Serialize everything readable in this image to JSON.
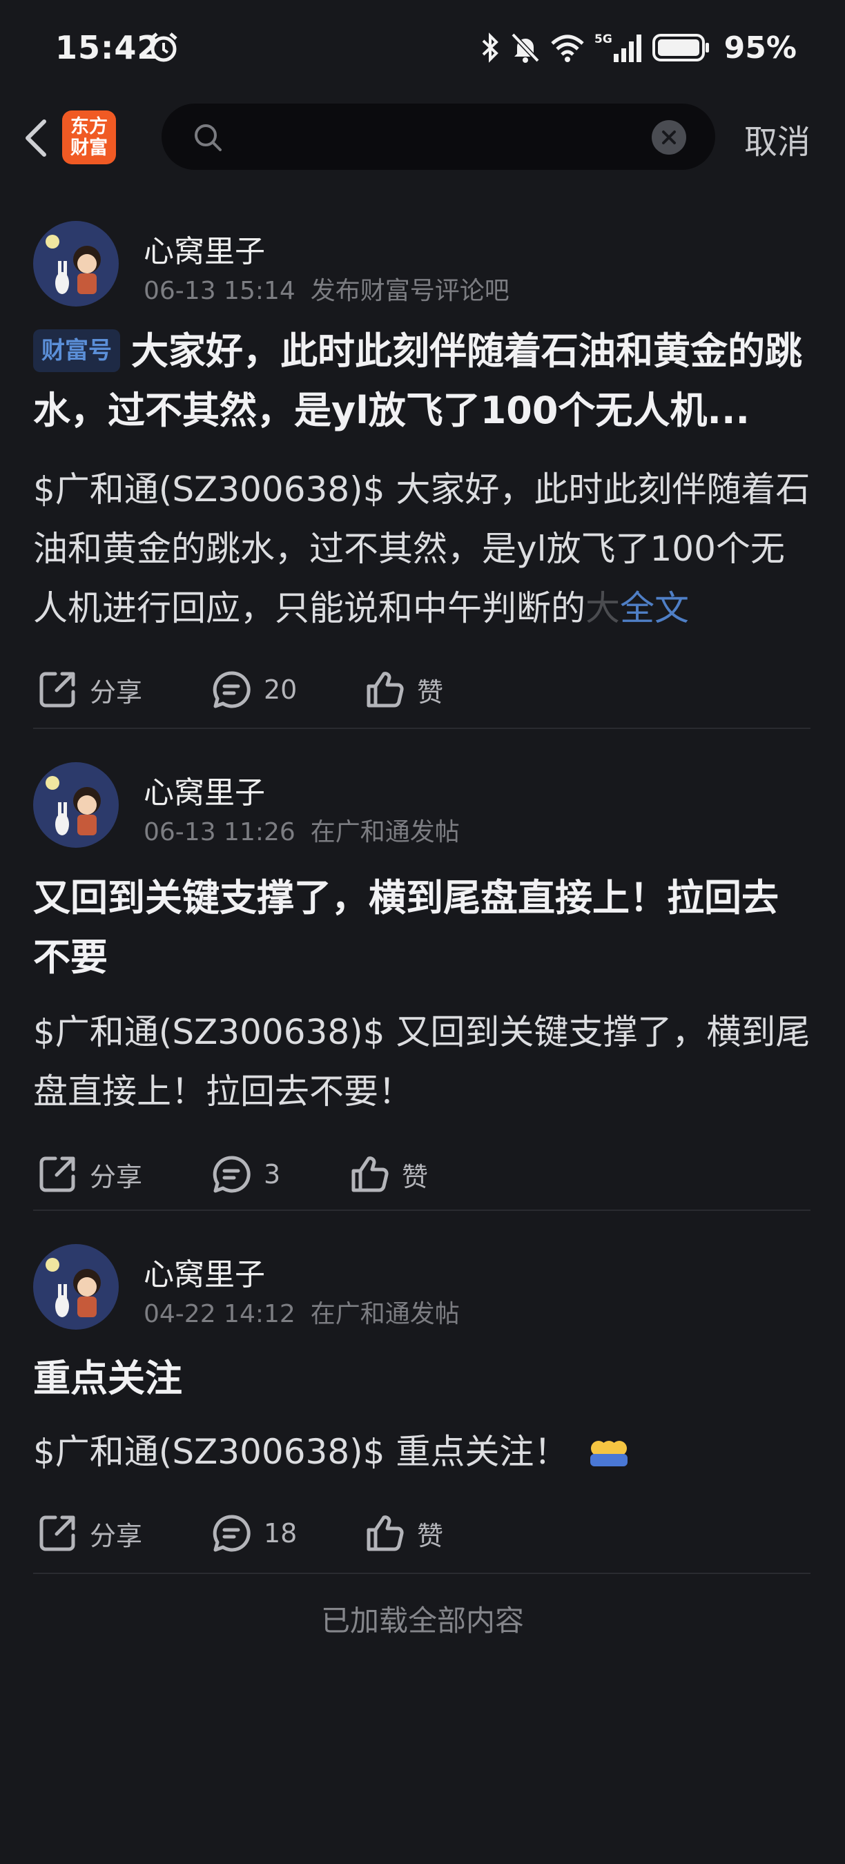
{
  "status_bar": {
    "time": "15:42",
    "battery": "95%",
    "icons": [
      "alarm-icon",
      "bluetooth-icon",
      "mute-icon",
      "wifi-icon",
      "5g-signal-icon",
      "battery-icon"
    ]
  },
  "header": {
    "logo_line1": "东方",
    "logo_line2": "财富",
    "search_value": "",
    "cancel_label": "取消"
  },
  "posts": [
    {
      "author": "心窝里子",
      "date": "06-13 15:14",
      "source": "发布财富号评论吧",
      "badge": "财富号",
      "title": "大家好，此时此刻伴随着石油和黄金的跳水，过不其然，是yl放飞了100个无人机...",
      "body": "$广和通(SZ300638)$ 大家好，此时此刻伴随着石油和黄金的跳水，过不其然，是yl放飞了100个无人机进行回应，只能说和中午判断的",
      "body_fade": "大",
      "more_label": "全文",
      "share_label": "分享",
      "comments": "20",
      "like_label": "赞"
    },
    {
      "author": "心窝里子",
      "date": "06-13 11:26",
      "source": "在广和通发帖",
      "title": "又回到关键支撑了，横到尾盘直接上！拉回去不要",
      "body": "$广和通(SZ300638)$ 又回到关键支撑了，横到尾盘直接上！拉回去不要！",
      "share_label": "分享",
      "comments": "3",
      "like_label": "赞"
    },
    {
      "author": "心窝里子",
      "date": "04-22 14:12",
      "source": "在广和通发帖",
      "title": "重点关注",
      "body": "$广和通(SZ300638)$ 重点关注！",
      "share_label": "分享",
      "comments": "18",
      "like_label": "赞"
    }
  ],
  "footer": "已加载全部内容"
}
